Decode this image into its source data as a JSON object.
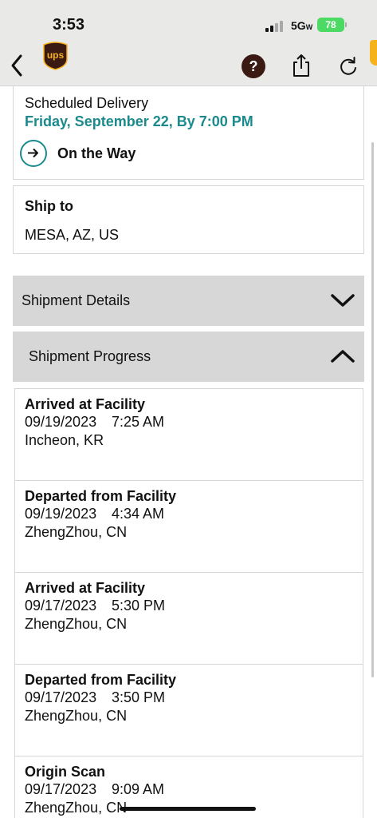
{
  "status_bar": {
    "time": "3:53",
    "network": "5G",
    "network_sub": "W",
    "battery": "78"
  },
  "nav": {
    "back_icon": "chevron-left-icon",
    "logo": "ups-logo",
    "help_label": "?",
    "share_icon": "share-icon",
    "refresh_icon": "refresh-icon"
  },
  "delivery": {
    "label": "Scheduled Delivery",
    "date": "Friday, September 22, By 7:00 PM",
    "status": "On the Way",
    "accent_color": "#1b8a8d"
  },
  "ship_to": {
    "title": "Ship to",
    "value": "MESA, AZ, US"
  },
  "sections": {
    "details_label": "Shipment Details",
    "progress_label": "Shipment Progress"
  },
  "progress": [
    {
      "status": "Arrived at Facility",
      "date": "09/19/2023",
      "time": "7:25 AM",
      "location": "Incheon, KR"
    },
    {
      "status": "Departed from Facility",
      "date": "09/19/2023",
      "time": "4:34 AM",
      "location": "ZhengZhou, CN"
    },
    {
      "status": "Arrived at Facility",
      "date": "09/17/2023",
      "time": "5:30 PM",
      "location": "ZhengZhou, CN"
    },
    {
      "status": "Departed from Facility",
      "date": "09/17/2023",
      "time": "3:50 PM",
      "location": "ZhengZhou, CN"
    },
    {
      "status": "Origin Scan",
      "date": "09/17/2023",
      "time": "9:09 AM",
      "location": "ZhengZhou, CN"
    }
  ]
}
